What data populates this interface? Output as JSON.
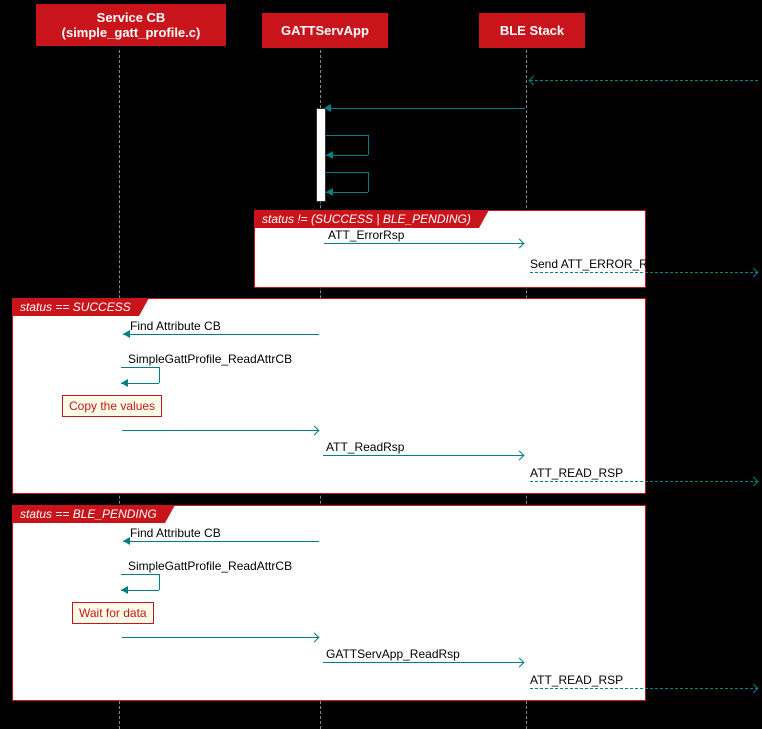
{
  "participants": {
    "p1_line1": "Service CB",
    "p1_line2": "(simple_gatt_profile.c)",
    "p2": "GATTServApp",
    "p3": "BLE Stack"
  },
  "groups": {
    "g1": "status != (SUCCESS | BLE_PENDING)",
    "g2": "status == SUCCESS",
    "g3": "status == BLE_PENDING"
  },
  "messages": {
    "m_err": "ATT_ErrorRsp",
    "m_send_err": "Send ATT_ERROR_RSP",
    "m_find1": "Find Attribute CB",
    "m_read1": "SimpleGattProfile_ReadAttrCB",
    "m_readrsp": "ATT_ReadRsp",
    "m_attread1": "ATT_READ_RSP",
    "m_find2": "Find Attribute CB",
    "m_read2": "SimpleGattProfile_ReadAttrCB",
    "m_gattread": "GATTServApp_ReadRsp",
    "m_attread2": "ATT_READ_RSP"
  },
  "notes": {
    "n1": "Copy the values",
    "n2": "Wait for data"
  }
}
